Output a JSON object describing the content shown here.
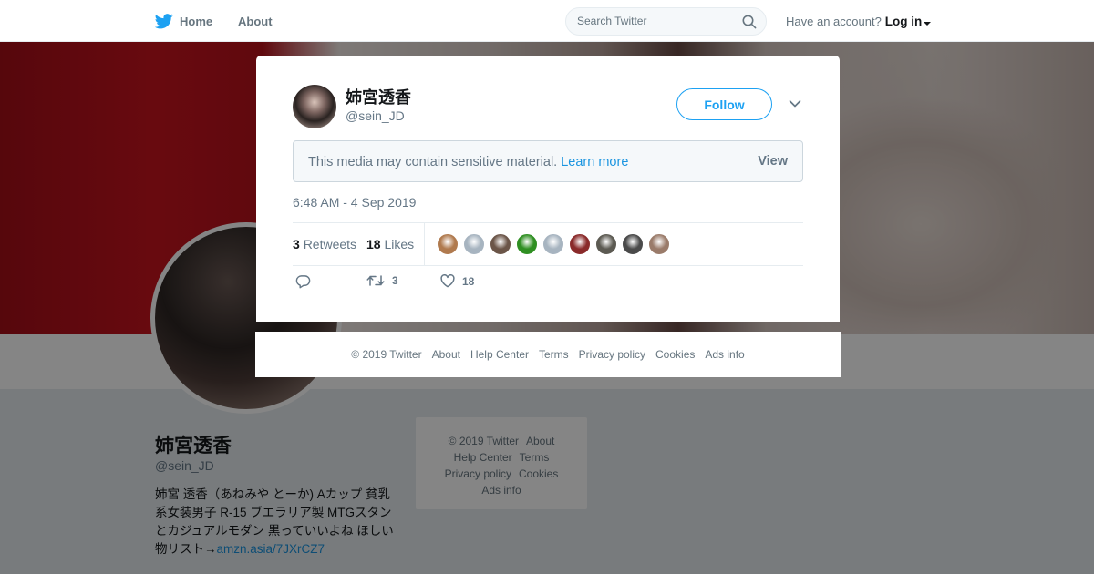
{
  "nav": {
    "home_label": "Home",
    "about_label": "About",
    "search_placeholder": "Search Twitter",
    "account_prompt": "Have an account?",
    "login_label": "Log in"
  },
  "profile": {
    "name": "姉宮透香",
    "handle": "@sein_JD",
    "bio_text": "姉宮 透香（あねみや とーか) Aカップ 貧乳系女装男子 R-15 ブエラリア製 MTGスタンとカジュアルモダン 黒っていいよね ほしい物リスト→",
    "bio_link": "amzn.asia/7JXrCZ7",
    "side_footer": {
      "copyright": "© 2019 Twitter",
      "about": "About",
      "help": "Help Center",
      "terms": "Terms",
      "privacy": "Privacy policy",
      "cookies": "Cookies",
      "ads": "Ads info"
    }
  },
  "tweet": {
    "author_name": "姉宮透香",
    "author_handle": "@sein_JD",
    "follow_label": "Follow",
    "sensitive_text": "This media may contain sensitive material.",
    "learn_more": "Learn more",
    "view_label": "View",
    "timestamp": "6:48 AM - 4 Sep 2019",
    "retweet_count": "3",
    "retweet_label": "Retweets",
    "like_count": "18",
    "like_label": "Likes",
    "action_retweets": "3",
    "action_likes": "18"
  },
  "likers": [
    {
      "color": "#b07a4e"
    },
    {
      "color": "#a7b4c0"
    },
    {
      "color": "#6b5548"
    },
    {
      "color": "#2f8f22"
    },
    {
      "color": "#a7b4c0"
    },
    {
      "color": "#8a2a2a"
    },
    {
      "color": "#5c5a52"
    },
    {
      "color": "#4a4a4a"
    },
    {
      "color": "#9a7b6a"
    }
  ],
  "footer": {
    "copyright": "© 2019 Twitter",
    "about": "About",
    "help": "Help Center",
    "terms": "Terms",
    "privacy": "Privacy policy",
    "cookies": "Cookies",
    "ads": "Ads info"
  },
  "colors": {
    "accent": "#1da1f2",
    "link": "#1b95e0",
    "muted": "#657786"
  }
}
